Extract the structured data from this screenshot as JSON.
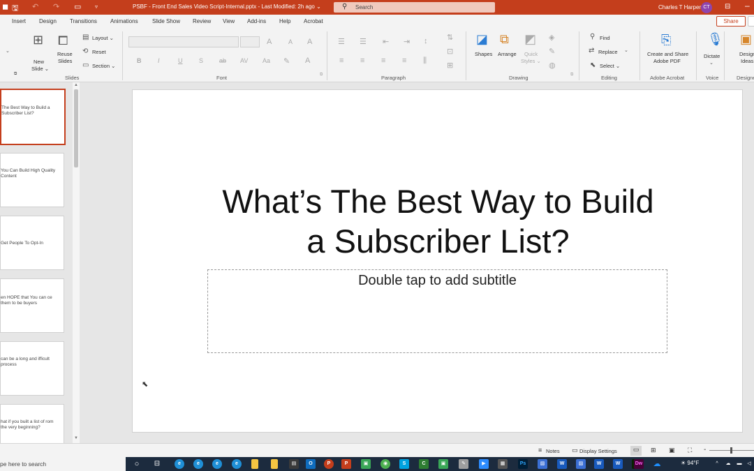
{
  "titlebar": {
    "doc_title": "PSBF - Front End Sales Video Script-Internal.pptx  -  Last Modified: 2h ago ⌄",
    "search_label": "Search",
    "user_name": "Charles T Harper",
    "avatar_initials": "CT"
  },
  "tabs": [
    "Insert",
    "Design",
    "Transitions",
    "Animations",
    "Slide Show",
    "Review",
    "View",
    "Add-ins",
    "Help",
    "Acrobat"
  ],
  "share_label": "Share",
  "ribbon": {
    "slides": {
      "label": "Slides",
      "new_slide": "New",
      "new_slide_2": "Slide ⌄",
      "reuse": "Reuse",
      "reuse_2": "Slides",
      "layout": "Layout ⌄",
      "reset": "Reset",
      "section": "Section ⌄"
    },
    "font": {
      "label": "Font"
    },
    "paragraph": {
      "label": "Paragraph"
    },
    "drawing": {
      "label": "Drawing",
      "shapes": "Shapes",
      "arrange": "Arrange",
      "quick_styles": "Quick",
      "quick_styles_2": "Styles ⌄"
    },
    "editing": {
      "label": "Editing",
      "find": "Find",
      "replace": "Replace",
      "select": "Select ⌄"
    },
    "adobe": {
      "label": "Adobe Acrobat",
      "create_share": "Create and Share",
      "create_share_2": "Adobe PDF"
    },
    "voice": {
      "label": "Voice",
      "dictate": "Dictate"
    },
    "designer": {
      "label": "Designer",
      "ideas": "Design",
      "ideas_2": "Ideas"
    }
  },
  "thumbnails": [
    "The Best Way to Build a Subscriber List?",
    "You Can Build High Quality Content",
    "Get People To Opt-In",
    "en HOPE that You can ce them to be buyers",
    "can be a long and ifficult process",
    "hat if you built a list of rom the very beginning?"
  ],
  "slide": {
    "title": "What’s The Best Way to Build a Subscriber List?",
    "subtitle_placeholder": "Double tap to add subtitle"
  },
  "statusbar": {
    "notes": "Notes",
    "display_settings": "Display Settings",
    "zoom_minus": "-"
  },
  "taskbar": {
    "search_placeholder": "pe here to search",
    "weather": "94°F"
  },
  "colors": {
    "accent": "#c43e1c",
    "titlebar": "#c43e1c",
    "taskbar": "#1c2b3e"
  }
}
